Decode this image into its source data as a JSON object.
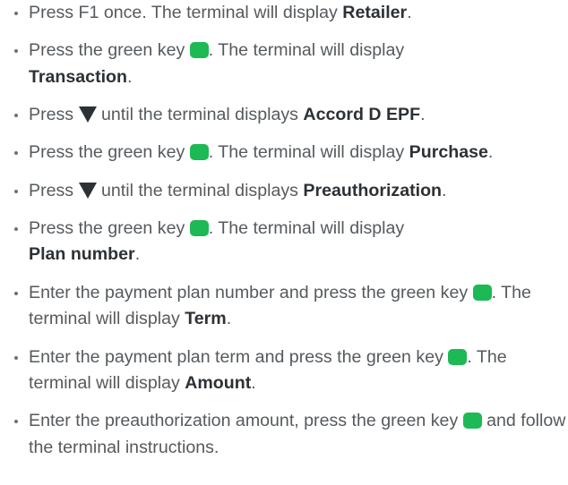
{
  "steps": [
    {
      "pre": "Press F1 once. The terminal will display ",
      "bold": "Retailer",
      "post": "."
    },
    {
      "pre": "Press the green key ",
      "mid": ". The terminal will display ",
      "bold": "Transaction",
      "post": "."
    },
    {
      "pre": "Press ",
      "mid": " until the terminal displays ",
      "bold": "Accord D EPF",
      "post": "."
    },
    {
      "pre": "Press the green key ",
      "mid": ". The terminal will display ",
      "bold": "Purchase",
      "post": "."
    },
    {
      "pre": "Press ",
      "mid": " until the terminal displays ",
      "bold": "Preauthorization",
      "post": "."
    },
    {
      "pre": "Press the green key ",
      "mid": ". The terminal will display ",
      "bold": "Plan number",
      "post": "."
    },
    {
      "pre": "Enter the payment plan number and press the green key ",
      "mid": ". The terminal will display ",
      "bold": "Term",
      "post": "."
    },
    {
      "pre": "Enter the payment plan term and press the green key ",
      "mid": ". The terminal will display ",
      "bold": "Amount",
      "post": "."
    },
    {
      "pre": "Enter the preauthorization amount, press the green key ",
      "mid": " and follow the terminal instructions."
    }
  ],
  "icons": {
    "green_key_color": "#1db954",
    "arrow_color": "#2c3135"
  }
}
